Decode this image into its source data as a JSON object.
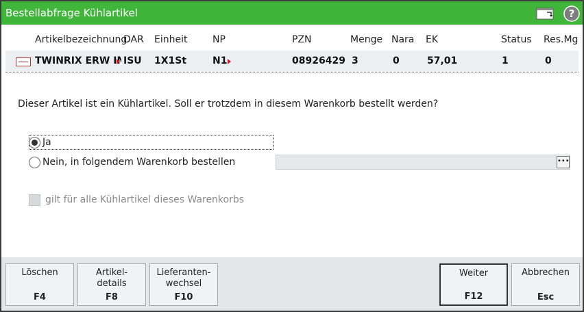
{
  "window": {
    "title": "Bestellabfrage Kühlartikel"
  },
  "titlebar_icons": [
    "window-settings-icon",
    "help-icon"
  ],
  "grid": {
    "columns": [
      "Artikelbezeichnung",
      "DAR",
      "Einheit",
      "NP",
      "PZN",
      "Menge",
      "Nara",
      "EK",
      "Status",
      "Res.Mg"
    ],
    "row": {
      "icon": "article-card-icon",
      "name": "TWINRIX ERW IM",
      "dar": "ISU",
      "einheit": "1X1St",
      "np": "N1",
      "pzn": "08926429",
      "menge": "3",
      "nara": "0",
      "ek": "57,01",
      "status": "1",
      "resmg": "0"
    }
  },
  "question": "Dieser Artikel ist ein Kühlartikel. Soll er trotzdem in diesem Warenkorb bestellt werden?",
  "options": {
    "yes_label": "Ja",
    "no_label": "Nein, in folgendem Warenkorb bestellen",
    "selected": "yes",
    "basket_value": ""
  },
  "checkbox": {
    "label": "gilt für alle Kühlartikel dieses Warenkorbs",
    "checked": false,
    "disabled": true
  },
  "footer": {
    "buttons": [
      {
        "label": "Löschen",
        "key": "F4"
      },
      {
        "label": "Artikel-\ndetails",
        "key": "F8"
      },
      {
        "label": "Lieferanten-\nwechsel",
        "key": "F10"
      },
      {
        "label": "Weiter",
        "key": "F12"
      },
      {
        "label": "Abbrechen",
        "key": "Esc"
      }
    ]
  },
  "colors": {
    "titlebar": "#3fb63a",
    "row_bg": "#eceff2",
    "footer_bg": "#e4e6e8",
    "flag_red": "#cc2020"
  }
}
